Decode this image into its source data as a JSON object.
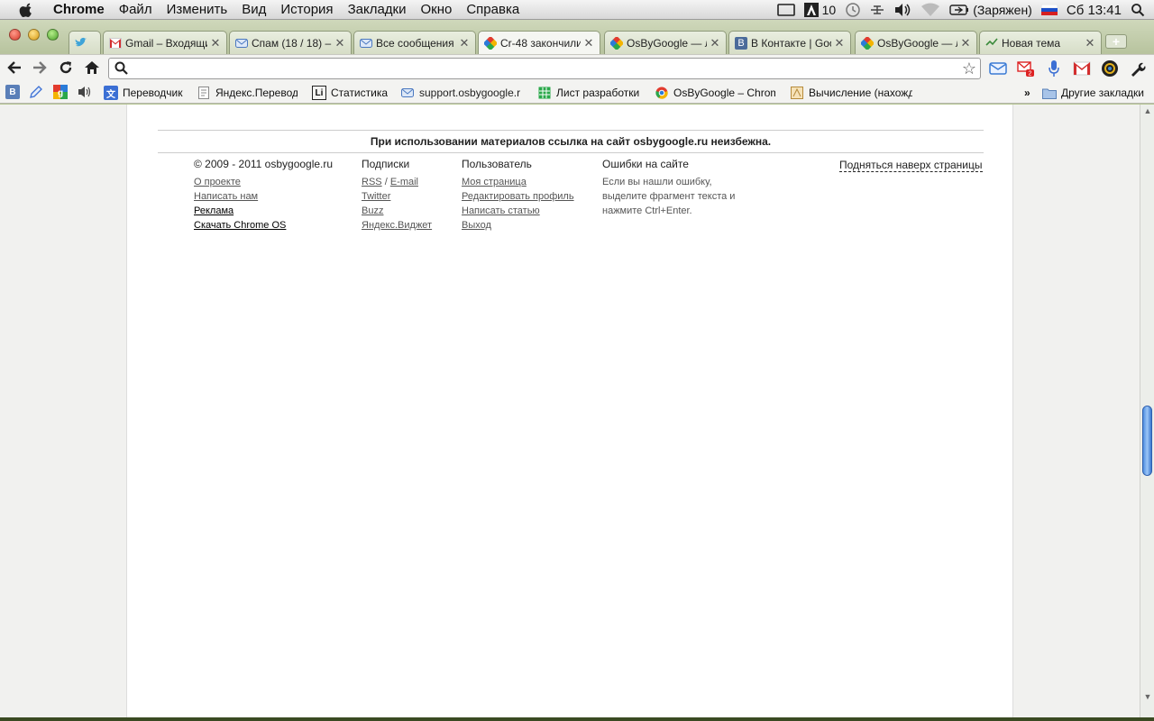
{
  "menubar": {
    "app_name": "Chrome",
    "items": [
      "Файл",
      "Изменить",
      "Вид",
      "История",
      "Закладки",
      "Окно",
      "Справка"
    ],
    "status": {
      "adobe_count": "10",
      "battery": "(Заряжен)",
      "clock": "Сб 13:41"
    }
  },
  "tabs": [
    {
      "title": "",
      "favicon": "twitter-icon"
    },
    {
      "title": "Gmail – Входящи",
      "favicon": "gmail-icon"
    },
    {
      "title": "Спам (18 / 18) –",
      "favicon": "mail-icon"
    },
    {
      "title": "Все сообщения –",
      "favicon": "mail-icon"
    },
    {
      "title": "Cr-48 закончили",
      "favicon": "osbygoogle-icon"
    },
    {
      "title": "OsByGoogle — лу",
      "favicon": "osbygoogle-icon"
    },
    {
      "title": "В Контакте | Goo",
      "favicon": "vk-icon"
    },
    {
      "title": "OsByGoogle — лу",
      "favicon": "osbygoogle-icon"
    },
    {
      "title": "Новая тема",
      "favicon": "forum-icon"
    }
  ],
  "omnibox": {
    "value": ""
  },
  "bookmarks": {
    "items": [
      {
        "label": "Переводчик"
      },
      {
        "label": "Яндекс.Перевод"
      },
      {
        "label": "Статистика"
      },
      {
        "label": "support.osbygoogle.r"
      },
      {
        "label": "Лист разработки"
      },
      {
        "label": "OsByGoogle – Chrom"
      },
      {
        "label": "Вычисление (нахожд"
      }
    ],
    "overflow": "»",
    "other": "Другие закладки"
  },
  "page": {
    "notice": "При использовании материалов ссылка на сайт osbygoogle.ru неизбежна.",
    "footer": {
      "copyright": "© 2009 - 2011 osbygoogle.ru",
      "about_links": [
        "О проекте",
        "Написать нам",
        "Реклама",
        "Скачать Chrome OS"
      ],
      "subscriptions_title": "Подписки",
      "rss": "RSS",
      "slash": "/",
      "email": "E-mail",
      "subscription_links": [
        "Twitter",
        "Buzz",
        "Яндекс.Виджет"
      ],
      "user_title": "Пользователь",
      "user_links": [
        "Моя страница",
        "Редактировать профиль",
        "Написать статью",
        "Выход"
      ],
      "errors_title": "Ошибки на сайте",
      "errors_text": "Если вы нашли ошибку, выделите фрагмент текста и нажмите Ctrl+Enter.",
      "scroll_top": "Подняться наверх страницы"
    }
  },
  "scrollbar": {
    "position": 0.42
  }
}
